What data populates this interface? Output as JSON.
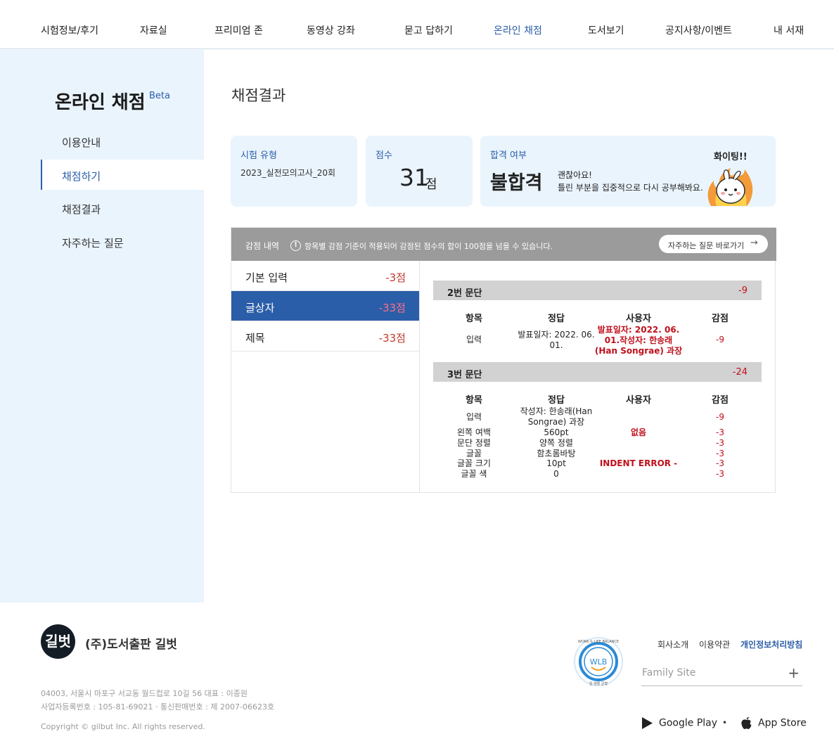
{
  "nav": {
    "items": [
      "시험정보/후기",
      "자료실",
      "프리미엄 존",
      "동영상 강좌",
      "묻고 답하기",
      "온라인 채점",
      "도서보기",
      "공지사항/이벤트",
      "내 서재"
    ],
    "active": "온라인 채점"
  },
  "sidebar": {
    "title": "온라인 채점",
    "beta": "Beta",
    "items": [
      "이용안내",
      "채점하기",
      "채점결과",
      "자주하는 질문"
    ],
    "active_index": 1
  },
  "page_title": "채점결과",
  "summary": {
    "type_label": "시험 유형",
    "type_value": "2023_실전모의고사_20회",
    "score_label": "점수",
    "score_value": "31",
    "score_unit": "점",
    "result_label": "합격 여부",
    "result_value": "불합격",
    "message_line1": "괜찮아요!",
    "message_line2": "틀린 부분을 집중적으로 다시 공부해봐요.",
    "mascot_text": "화이팅!!"
  },
  "deductions": {
    "header_label": "감점 내역",
    "notice": "항목별 감점 기준이 적용되어 감점된 점수의 합이 100점을 넘을 수 있습니다.",
    "faq_button": "자주하는 질문 바로가기",
    "categories": [
      {
        "name": "기본 입력",
        "score": "-3점"
      },
      {
        "name": "글상자",
        "score": "-33점"
      },
      {
        "name": "제목",
        "score": "-33점"
      }
    ],
    "active_category": 1,
    "columns": [
      "항목",
      "정답",
      "사용자",
      "감점"
    ],
    "paragraphs": [
      {
        "title": "2번 문단",
        "total": "-9",
        "rows": [
          {
            "item": "입력",
            "answer": [
              "발표일자: 2022. 06.",
              "01."
            ],
            "user": [
              "발표일자: 2022. 06.",
              "01.작성자: 한송래",
              "(Han Songrae) 과장"
            ],
            "deduct": "-9"
          }
        ]
      },
      {
        "title": "3번 문단",
        "total": "-24",
        "rows": [
          {
            "item": "입력",
            "answer": [
              "작성자: 한송래(Han",
              "Songrae) 과장"
            ],
            "user": [],
            "deduct": "-9"
          },
          {
            "item": "왼쪽 여백",
            "answer": [
              "560pt"
            ],
            "user": [
              "없음"
            ],
            "deduct": "-3"
          },
          {
            "item": "문단 정렬",
            "answer": [
              "양쪽 정렬"
            ],
            "user": [],
            "deduct": "-3"
          },
          {
            "item": "글꼴",
            "answer": [
              "함초롬바탕"
            ],
            "user": [],
            "deduct": "-3"
          },
          {
            "item": "글꼴 크기",
            "answer": [
              "10pt"
            ],
            "user": [
              "INDENT ERROR -"
            ],
            "deduct": "-3"
          },
          {
            "item": "글꼴 색",
            "answer": [
              "0"
            ],
            "user": [],
            "deduct": "-3"
          }
        ]
      }
    ]
  },
  "footer": {
    "logo_text": "길벗",
    "company": "(주)도서출판 길벗",
    "address": "04003, 서울시 마포구 서교동 월드컵로 10길 56 대표 : 이종원",
    "registration": "사업자등록번호 : 105-81-69021  ·  통신판매번호 : 제 2007-06623호",
    "copyright": "Copyright © gilbut Inc. All rights reserved.",
    "wlb_text": "WLB",
    "wlb_ring_top": "WORK & LIFE BALANCE",
    "wlb_ring_bottom": "일·생활 균형",
    "links": [
      "회사소개",
      "이용약관",
      "개인정보처리방침"
    ],
    "family_site": "Family Site",
    "google_play": "Google Play",
    "app_store": "App Store"
  },
  "colors": {
    "accent": "#2b5ea8",
    "sidebar_bg": "#eaf4fd",
    "deduct_red": "#c0101c",
    "panel_header": "#9b9b9b"
  }
}
